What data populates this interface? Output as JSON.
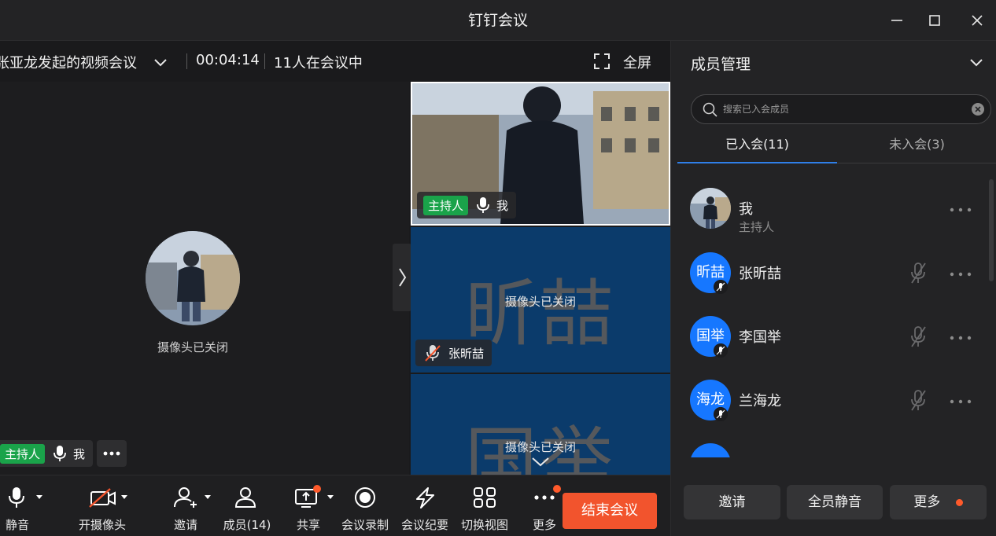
{
  "window": {
    "title": "钉钉会议"
  },
  "meeting": {
    "title": "张亚龙发起的视频会议",
    "timer": "00:04:14",
    "participants": "11人在会议中",
    "fullscreen_label": "全屏"
  },
  "stage": {
    "camera_off": "摄像头已关闭",
    "host_badge": "主持人",
    "name": "我"
  },
  "tiles": [
    {
      "host_badge": "主持人",
      "name": "我"
    },
    {
      "big": "昕喆",
      "camera_off": "摄像头已关闭",
      "name": "张昕喆"
    },
    {
      "big": "国举",
      "camera_off": "摄像头已关闭"
    }
  ],
  "toolbar": {
    "mute": "静音",
    "camera": "开摄像头",
    "invite": "邀请",
    "members": "成员(14)",
    "share": "共享",
    "record": "会议录制",
    "minutes": "会议纪要",
    "view": "切换视图",
    "more": "更多",
    "end": "结束会议"
  },
  "panel": {
    "title": "成员管理",
    "search_placeholder": "搜索已入会成员",
    "tab_joined": "已入会(11)",
    "tab_not_joined": "未入会(3)",
    "members": [
      {
        "name": "我",
        "role": "主持人"
      },
      {
        "avatar_text": "昕喆",
        "name": "张昕喆"
      },
      {
        "avatar_text": "国举",
        "name": "李国举"
      },
      {
        "avatar_text": "海龙",
        "name": "兰海龙"
      }
    ],
    "buttons": {
      "invite": "邀请",
      "mute_all": "全员静音",
      "more": "更多"
    }
  },
  "colors": {
    "accent": "#1677ff",
    "end": "#f2542d",
    "host": "#1aa34a",
    "tile_bg": "#0b3b6b"
  }
}
